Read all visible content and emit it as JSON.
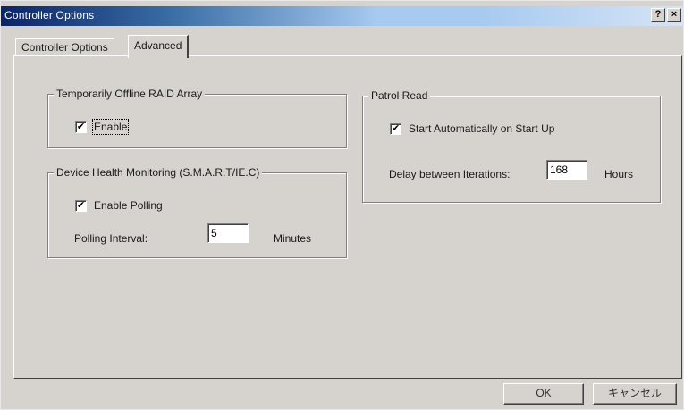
{
  "window": {
    "title": "Controller Options",
    "help_glyph": "?",
    "close_glyph": "×"
  },
  "tabs": [
    {
      "label": "Controller Options",
      "active": false
    },
    {
      "label": "Advanced",
      "active": true
    }
  ],
  "raid_group": {
    "title": "Temporarily  Offline RAID Array",
    "enable_label": "Enable",
    "enable_checked": true
  },
  "smart_group": {
    "title": "Device Health Monitoring (S.M.A.R.T/IE.C)",
    "polling_label": "Enable Polling",
    "polling_checked": true,
    "interval_label": "Polling Interval:",
    "interval_value": "5",
    "interval_unit": "Minutes"
  },
  "patrol_group": {
    "title": "Patrol Read",
    "auto_label": "Start Automatically on Start Up",
    "auto_checked": true,
    "delay_label": "Delay between Iterations:",
    "delay_value": "168",
    "delay_unit": "Hours"
  },
  "buttons": {
    "ok": "OK",
    "cancel": "キャンセル"
  },
  "check_glyph": "✔"
}
